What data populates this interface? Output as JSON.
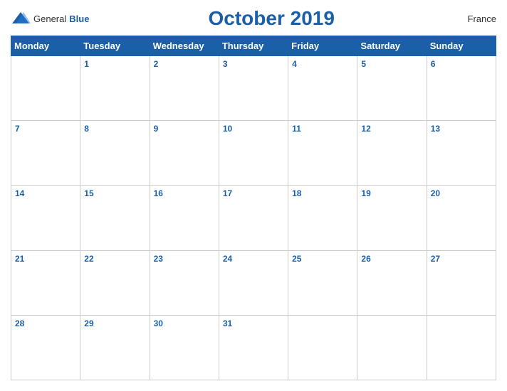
{
  "header": {
    "logo_general": "General",
    "logo_blue": "Blue",
    "title": "October 2019",
    "country": "France"
  },
  "days": [
    "Monday",
    "Tuesday",
    "Wednesday",
    "Thursday",
    "Friday",
    "Saturday",
    "Sunday"
  ],
  "weeks": [
    [
      null,
      1,
      2,
      3,
      4,
      5,
      6
    ],
    [
      7,
      8,
      9,
      10,
      11,
      12,
      13
    ],
    [
      14,
      15,
      16,
      17,
      18,
      19,
      20
    ],
    [
      21,
      22,
      23,
      24,
      25,
      26,
      27
    ],
    [
      28,
      29,
      30,
      31,
      null,
      null,
      null
    ]
  ]
}
